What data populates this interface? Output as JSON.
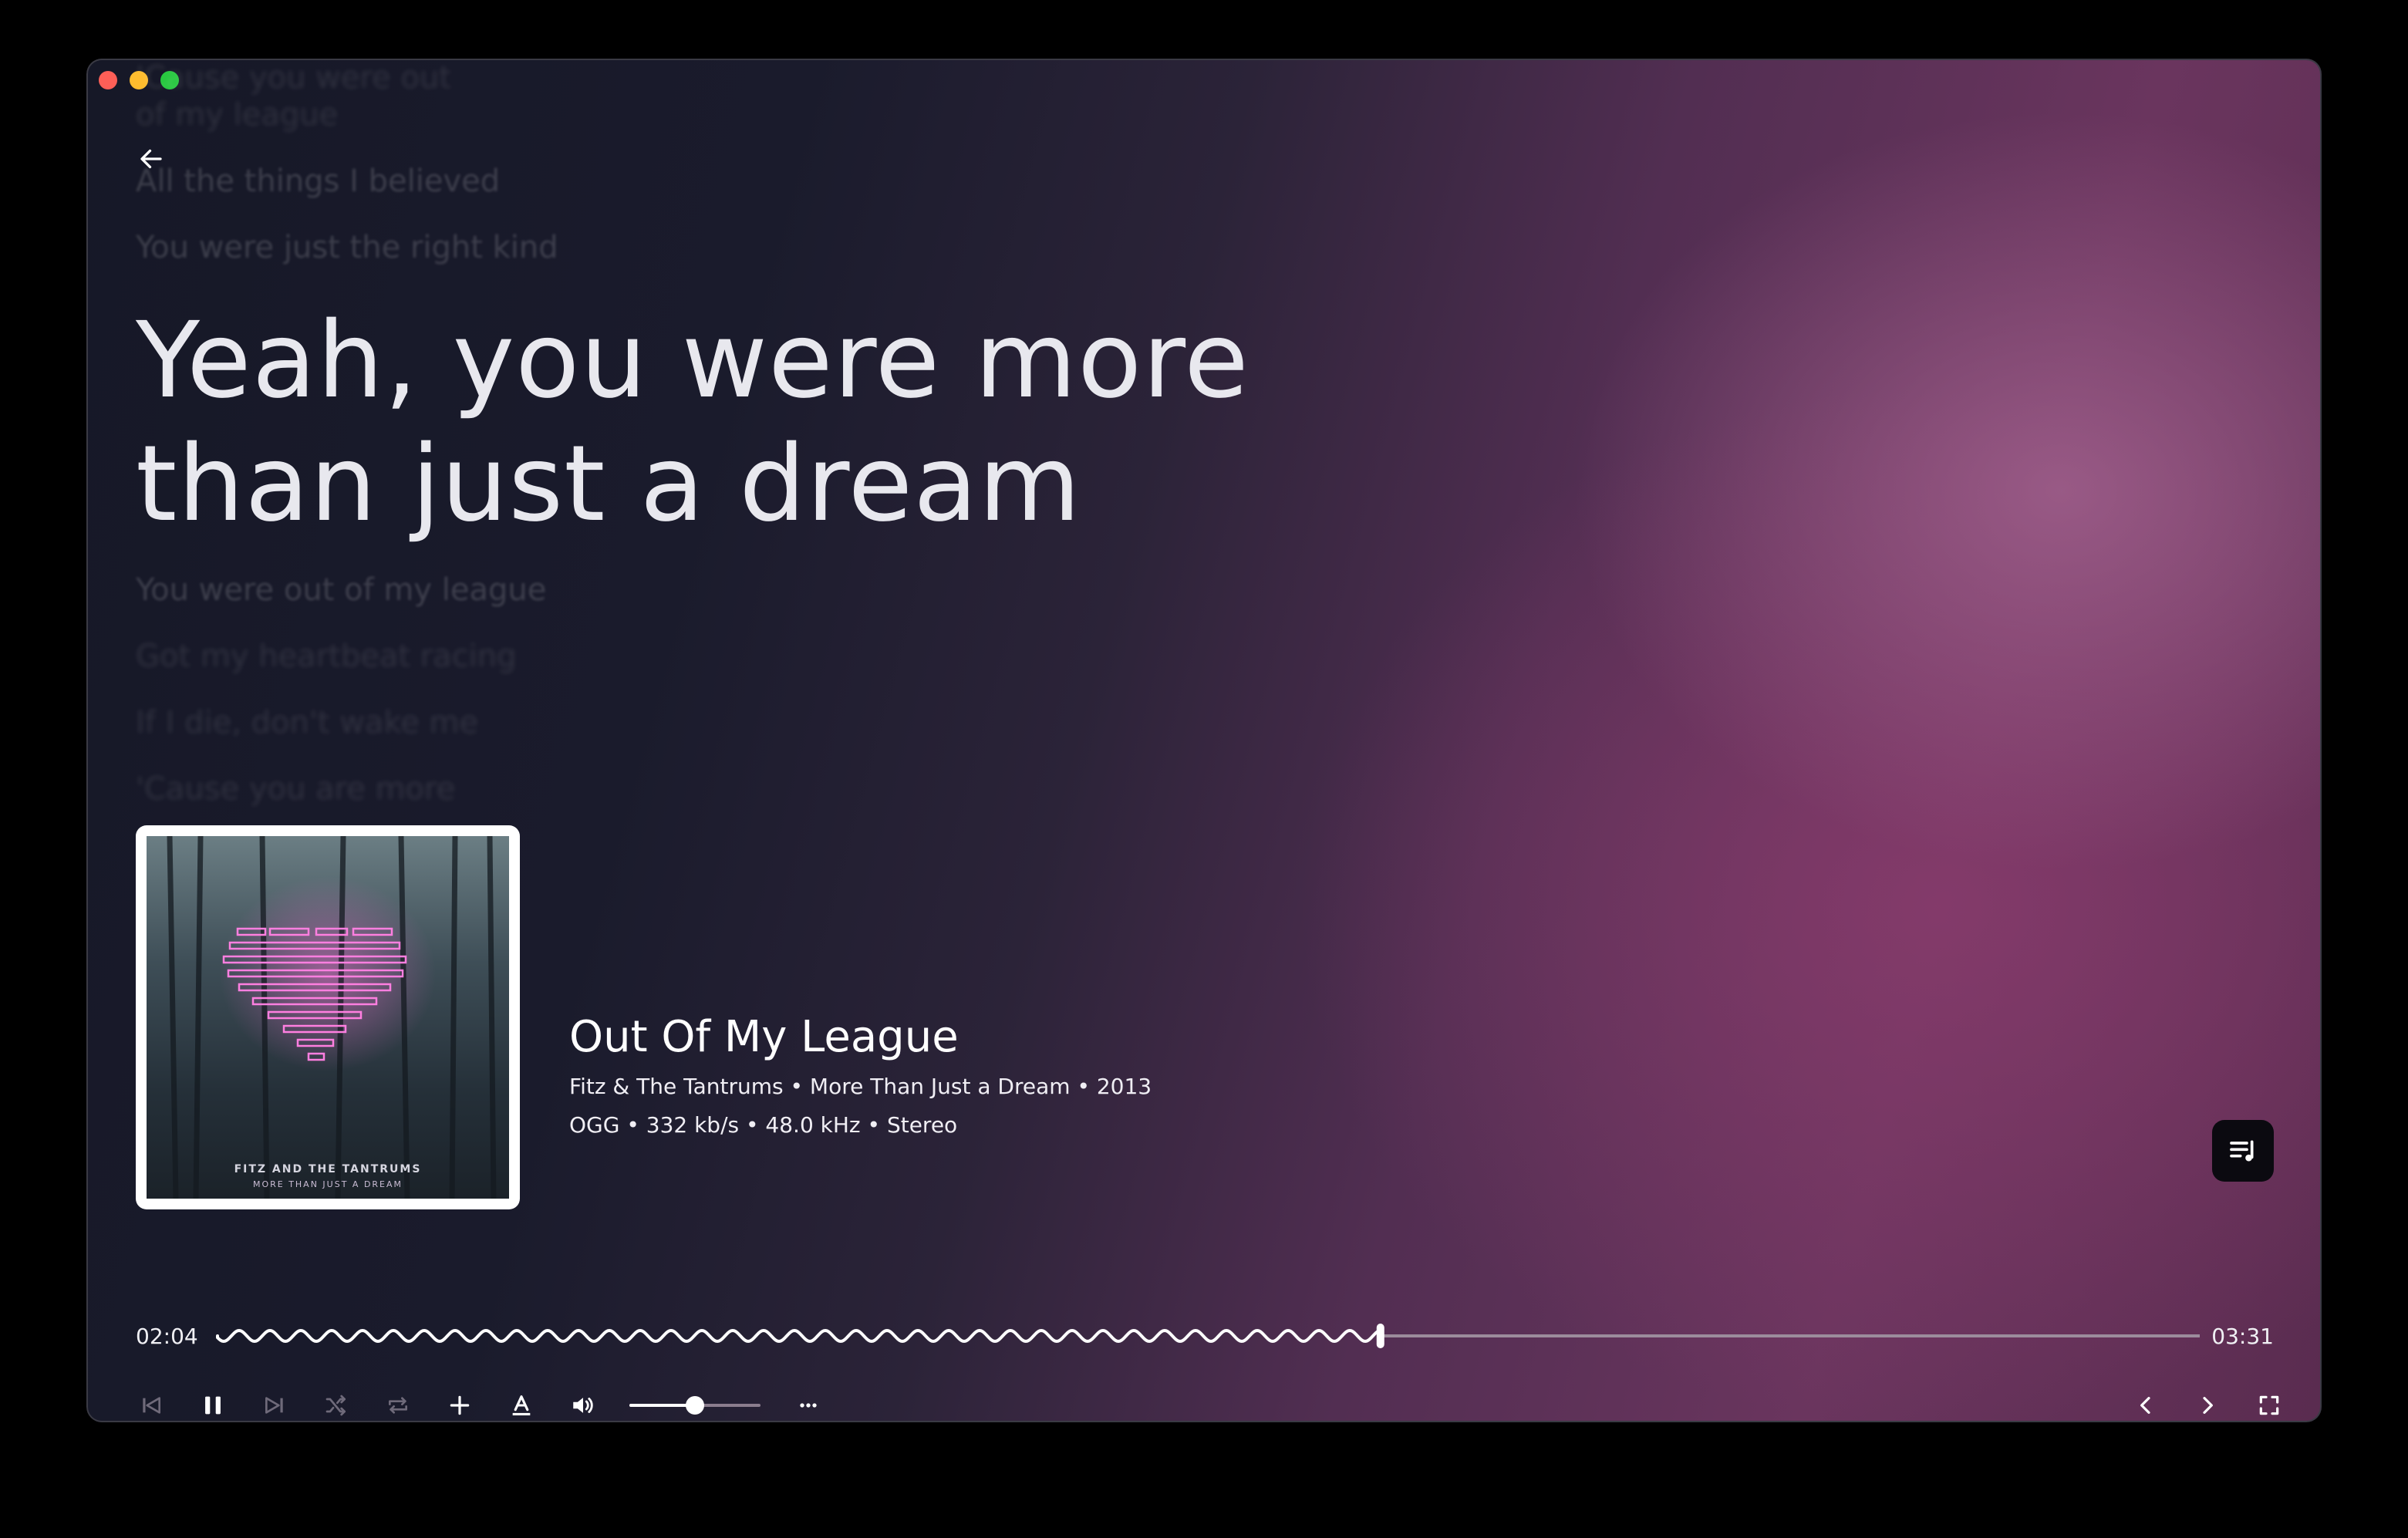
{
  "lyrics": {
    "before": [
      "'Cause you were out",
      "of my league",
      "All the things I believed",
      "You were just the right kind"
    ],
    "current": "Yeah, you were more\nthan just a dream",
    "after": [
      "You were out of my league",
      "Got my heartbeat racing",
      "If I die, don't wake me",
      "'Cause you are more"
    ]
  },
  "cover": {
    "band": "FITZ AND THE TANTRUMS",
    "album": "MORE THAN JUST A DREAM"
  },
  "track": {
    "title": "Out Of My League",
    "details": "Fitz & The Tantrums • More Than Just a Dream • 2013",
    "format": "OGG • 332 kb/s • 48.0 kHz • Stereo"
  },
  "playback": {
    "elapsed": "02:04",
    "duration": "03:31",
    "progress_fraction": 0.587,
    "volume_fraction": 0.5,
    "state": "playing"
  },
  "icons": {
    "back": "arrow-left-icon",
    "queue": "queue-list-icon",
    "prev": "skip-previous-icon",
    "pause": "pause-icon",
    "next": "skip-next-icon",
    "shuffle": "shuffle-icon",
    "repeat": "repeat-icon",
    "add": "plus-icon",
    "lyrics_style": "text-format-icon",
    "volume": "volume-icon",
    "more": "more-icon",
    "nav_back": "chevron-left-icon",
    "nav_forward": "chevron-right-icon",
    "fullscreen": "fullscreen-icon"
  },
  "colors": {
    "accent": "#ffffff",
    "disabled": "#6f6a7a",
    "track_line": "#9c8c9c"
  }
}
